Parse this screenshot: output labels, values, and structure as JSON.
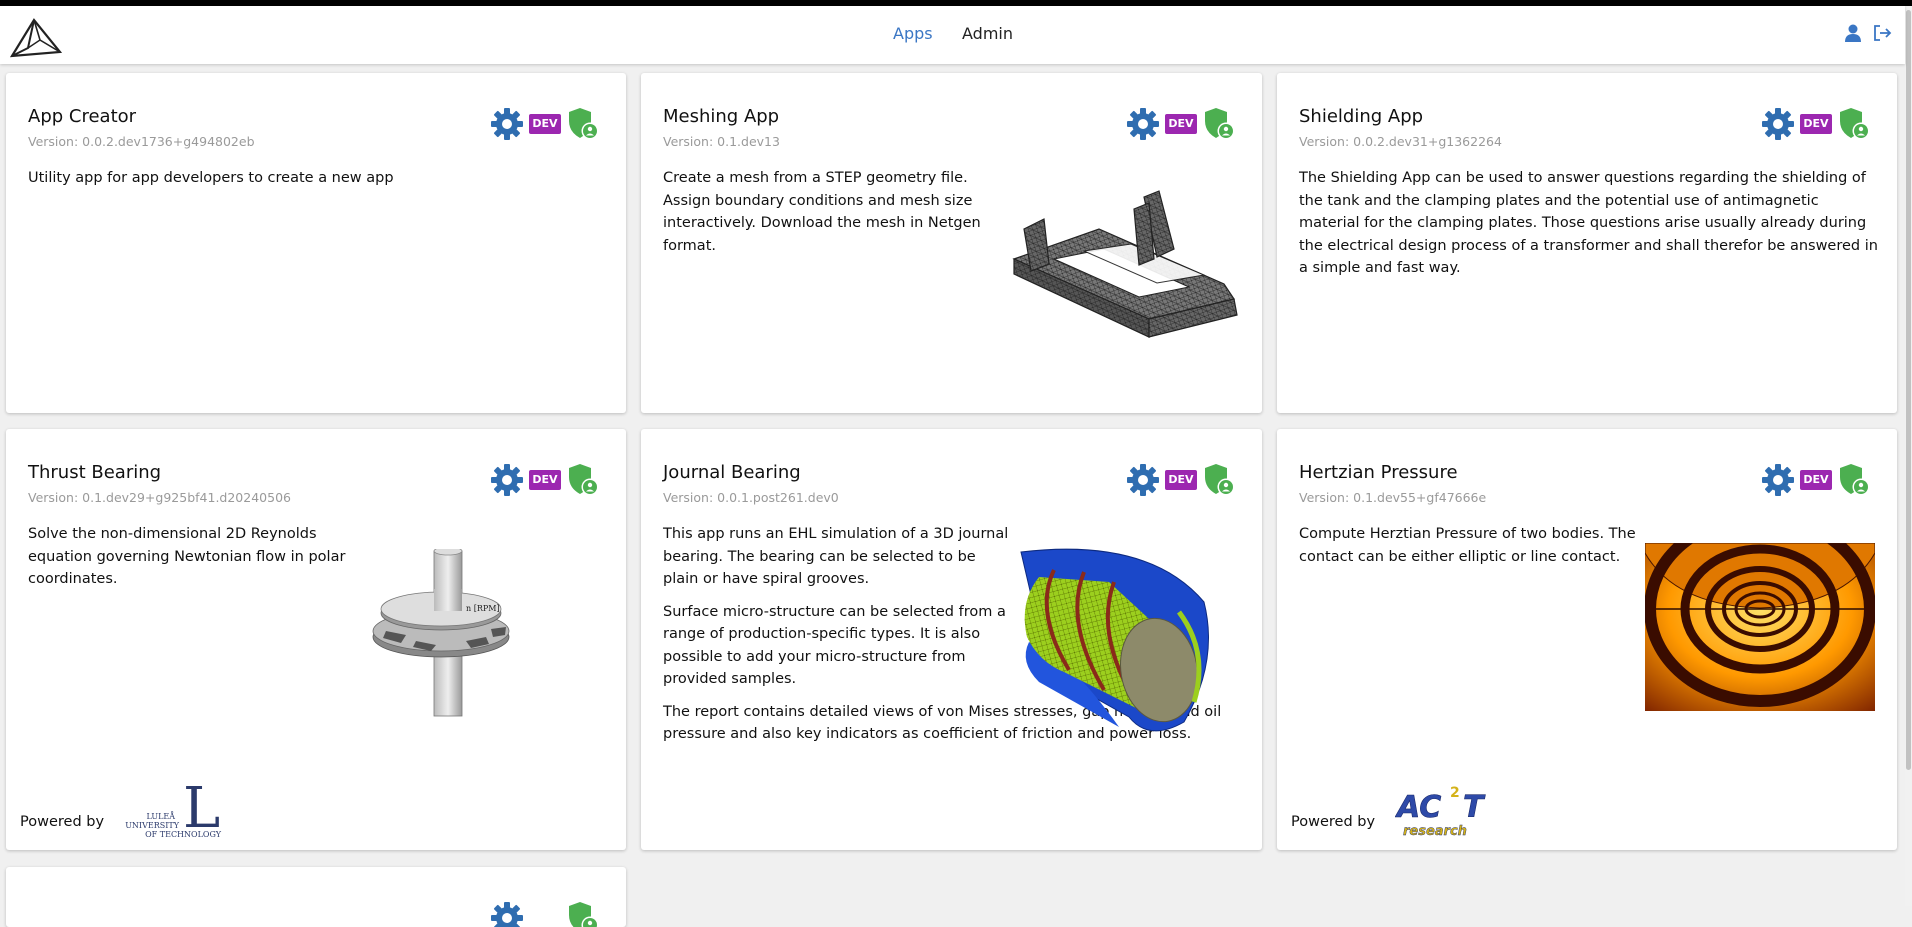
{
  "nav": {
    "apps": "Apps",
    "admin": "Admin"
  },
  "icons": {
    "logo": "mountain-logo-icon",
    "user": "user-icon",
    "logout": "logout-icon",
    "settings": "gear-icon",
    "permissions": "shield-user-icon"
  },
  "colors": {
    "accent": "#3a76c4",
    "gear": "#2f6db0",
    "dev": "#9c27b0",
    "shield": "#4caf50"
  },
  "dev_badge": "DEV",
  "cards": [
    {
      "title": "App Creator",
      "version": "Version: 0.0.2.dev1736+g494802eb",
      "description": [
        "Utility app for app developers to create a new app"
      ]
    },
    {
      "title": "Meshing App",
      "version": "Version: 0.1.dev13",
      "description": [
        "Create a mesh from a STEP geometry file. Assign boundary conditions and mesh size interactively. Download the mesh in Netgen format."
      ]
    },
    {
      "title": "Shielding App",
      "version": "Version: 0.0.2.dev31+g1362264",
      "description": [
        "The Shielding App can be used to answer questions regarding the shielding of the tank and the clamping plates and the potential use of antimagnetic material for the clamping plates. Those questions arise usually already during the electrical design process of a transformer and shall therefor be answered in a simple and fast way."
      ]
    },
    {
      "title": "Thrust Bearing",
      "version": "Version: 0.1.dev29+g925bf41.d20240506",
      "description": [
        "Solve the non-dimensional 2D Reynolds equation governing Newtonian flow in polar coordinates."
      ],
      "image_label": "n [RPM]",
      "powered_by": "Powered by",
      "logo_text": [
        "LULEÅ",
        "UNIVERSITY",
        "OF TECHNOLOGY"
      ]
    },
    {
      "title": "Journal Bearing",
      "version": "Version: 0.0.1.post261.dev0",
      "description": [
        "This app runs an EHL simulation of a 3D journal bearing. The bearing can be selected to be plain or have spiral grooves.",
        "Surface micro-structure can be selected from a range of production-specific types. It is also possible to add your micro-structure from provided samples.",
        "The report contains detailed views of von Mises stresses, gap heights and oil pressure and also key indicators as coefficient of friction and power loss."
      ]
    },
    {
      "title": "Hertzian Pressure",
      "version": "Version: 0.1.dev55+gf47666e",
      "description": [
        "Compute Herztian Pressure of two bodies. The contact can be either elliptic or line contact."
      ],
      "powered_by": "Powered by",
      "logo_text": [
        "AC",
        "2",
        "T",
        "research"
      ]
    }
  ]
}
